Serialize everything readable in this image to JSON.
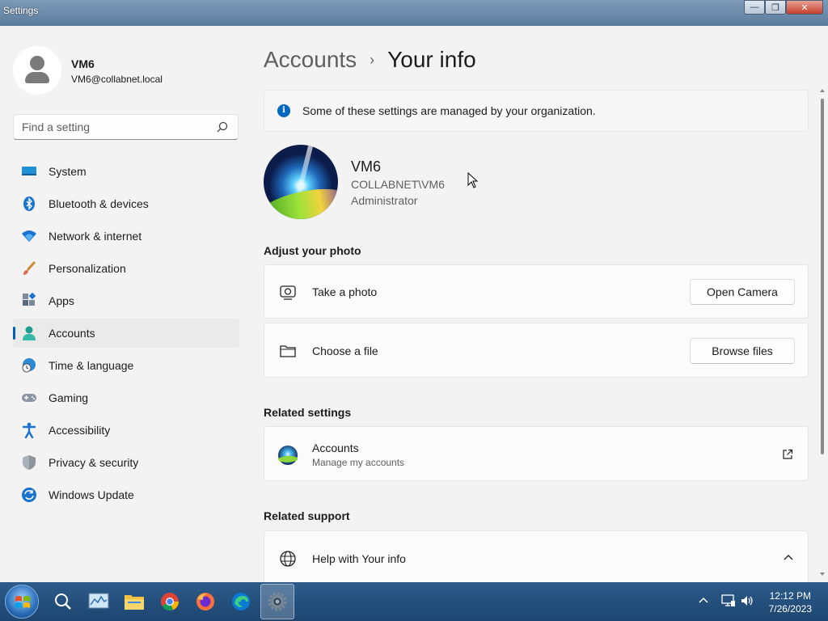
{
  "window": {
    "title": "Settings",
    "minimize": "—",
    "maximize": "❐",
    "close": "✕"
  },
  "profile": {
    "name": "VM6",
    "email": "VM6@collabnet.local"
  },
  "search": {
    "placeholder": "Find a setting"
  },
  "nav": {
    "items": [
      {
        "label": "System",
        "icon": "monitor-icon"
      },
      {
        "label": "Bluetooth & devices",
        "icon": "bluetooth-icon"
      },
      {
        "label": "Network & internet",
        "icon": "wifi-icon"
      },
      {
        "label": "Personalization",
        "icon": "brush-icon"
      },
      {
        "label": "Apps",
        "icon": "apps-icon"
      },
      {
        "label": "Accounts",
        "icon": "person-icon",
        "active": true
      },
      {
        "label": "Time & language",
        "icon": "globe-clock-icon"
      },
      {
        "label": "Gaming",
        "icon": "gamepad-icon"
      },
      {
        "label": "Accessibility",
        "icon": "accessibility-icon"
      },
      {
        "label": "Privacy & security",
        "icon": "shield-icon"
      },
      {
        "label": "Windows Update",
        "icon": "update-icon"
      }
    ]
  },
  "main": {
    "breadcrumb": {
      "parent": "Accounts",
      "separator": "›",
      "current": "Your info"
    },
    "info_banner": "Some of these settings are managed by your organization.",
    "user": {
      "name": "VM6",
      "domain": "COLLABNET\\VM6",
      "role": "Administrator"
    },
    "adjust_photo": {
      "heading": "Adjust your photo",
      "take_photo": {
        "label": "Take a photo",
        "button": "Open Camera"
      },
      "choose_file": {
        "label": "Choose a file",
        "button": "Browse files"
      }
    },
    "related_settings": {
      "heading": "Related settings",
      "accounts": {
        "label": "Accounts",
        "sublabel": "Manage my accounts"
      }
    },
    "related_support": {
      "heading": "Related support",
      "help": {
        "label": "Help with Your info"
      }
    }
  },
  "taskbar": {
    "apps": [
      "start-button",
      "search-icon",
      "task-manager-icon",
      "file-explorer-icon",
      "chrome-icon",
      "firefox-icon",
      "edge-icon",
      "settings-icon"
    ],
    "clock": {
      "time": "12:12 PM",
      "date": "7/26/2023"
    }
  },
  "colors": {
    "accent": "#005fb8",
    "taskbar": "#1d4570",
    "background": "#f3f3f3"
  }
}
